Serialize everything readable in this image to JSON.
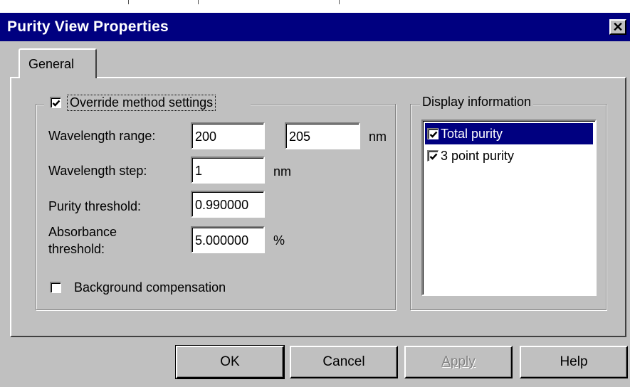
{
  "window": {
    "title": "Purity View Properties",
    "close_glyph": "✕"
  },
  "tabs": [
    {
      "label": "General",
      "selected": true
    }
  ],
  "override_group": {
    "override_label": "Override method settings",
    "override_checked": true,
    "wavelength_range_label": "Wavelength range:",
    "wavelength_range_min": "200",
    "wavelength_range_max": "205",
    "wavelength_range_unit": "nm",
    "wavelength_step_label": "Wavelength step:",
    "wavelength_step_value": "1",
    "wavelength_step_unit": "nm",
    "purity_threshold_label": "Purity threshold:",
    "purity_threshold_value": "0.990000",
    "absorbance_threshold_label_line1": "Absorbance",
    "absorbance_threshold_label_line2": "threshold:",
    "absorbance_threshold_value": "5.000000",
    "absorbance_threshold_unit": "%",
    "background_compensation_label": "Background compensation",
    "background_compensation_checked": false
  },
  "display_group": {
    "legend": "Display information",
    "items": [
      {
        "label": "Total purity",
        "checked": true,
        "selected": true
      },
      {
        "label": "3 point purity",
        "checked": true,
        "selected": false
      }
    ]
  },
  "buttons": {
    "ok": "OK",
    "cancel": "Cancel",
    "apply": "Apply",
    "help": "Help"
  },
  "colors": {
    "title_bar": "#000080",
    "dialog_face": "#c0c0c0",
    "selection": "#000080"
  }
}
